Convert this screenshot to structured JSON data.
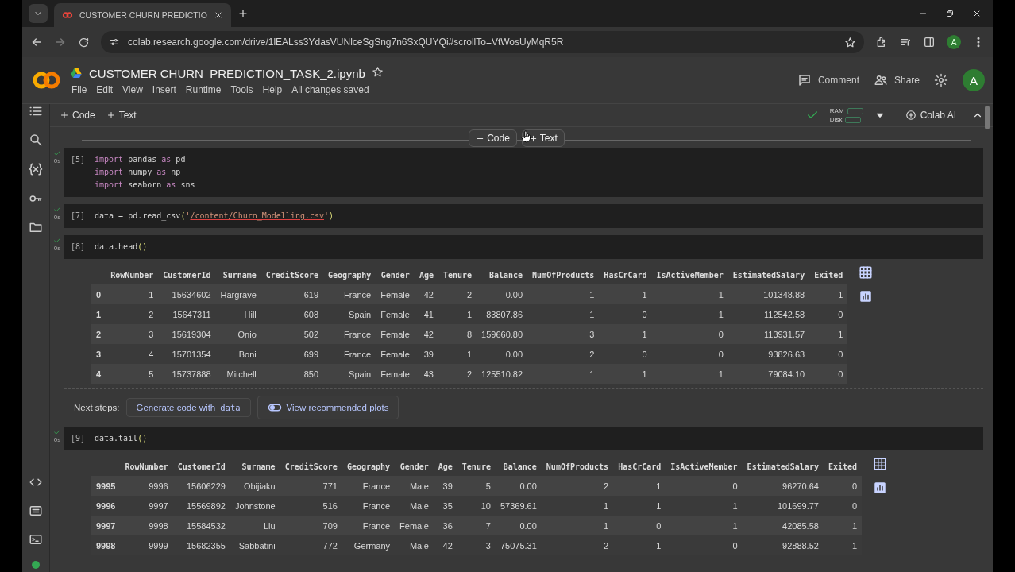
{
  "browser": {
    "tab": {
      "title": "CUSTOMER CHURN PREDICTIO",
      "selected": true
    },
    "url": "colab.research.google.com/drive/1lEALss3YdasVUNlceSgSng7n6SxQUYQi#scrollTo=VtWosUyMqR5R",
    "profile": "A"
  },
  "notebook": {
    "title": "CUSTOMER CHURN  PREDICTION_TASK_2.ipynb",
    "starred": false,
    "menu": [
      "File",
      "Edit",
      "View",
      "Insert",
      "Runtime",
      "Tools",
      "Help"
    ],
    "save_status": "All changes saved",
    "actions": [
      "Comment",
      "Share"
    ],
    "avatar": "A"
  },
  "toolbar": {
    "buttons": [
      "Code",
      "Text"
    ],
    "connected": true,
    "resources": [
      "RAM",
      "Disk"
    ],
    "ai": "Colab AI"
  },
  "insert_bar": [
    "Code",
    "Text"
  ],
  "cells": [
    {
      "count": "[5]",
      "duration": "0s",
      "done": true,
      "lines": [
        [
          {
            "text": "import",
            "kind": "keyword"
          },
          {
            "text": " pandas ",
            "kind": "plain"
          },
          {
            "text": "as",
            "kind": "keyword"
          },
          {
            "text": " pd",
            "kind": "plain"
          }
        ],
        [
          {
            "text": "import",
            "kind": "keyword"
          },
          {
            "text": " numpy ",
            "kind": "plain"
          },
          {
            "text": "as",
            "kind": "keyword"
          },
          {
            "text": " np",
            "kind": "plain"
          }
        ],
        [
          {
            "text": "import",
            "kind": "keyword"
          },
          {
            "text": " seaborn ",
            "kind": "plain"
          },
          {
            "text": "as",
            "kind": "keyword"
          },
          {
            "text": " sns",
            "kind": "plain"
          }
        ]
      ]
    },
    {
      "count": "[7]",
      "duration": "0s",
      "done": true,
      "lines": [
        [
          {
            "text": "data = pd.read_csv",
            "kind": "plain"
          },
          {
            "text": "(",
            "kind": "paren"
          },
          {
            "text": "'",
            "kind": "quote"
          },
          {
            "text": "/content/Churn_Modelling.csv",
            "kind": "path"
          },
          {
            "text": "'",
            "kind": "quote"
          },
          {
            "text": ")",
            "kind": "paren"
          }
        ]
      ]
    },
    {
      "count": "[8]",
      "duration": "0s",
      "done": true,
      "lines": [
        [
          {
            "text": "data.head",
            "kind": "plain"
          },
          {
            "text": "()",
            "kind": "paren"
          }
        ]
      ],
      "output": {
        "columns": [
          "RowNumber",
          "CustomerId",
          "Surname",
          "CreditScore",
          "Geography",
          "Gender",
          "Age",
          "Tenure",
          "Balance",
          "NumOfProducts",
          "HasCrCard",
          "IsActiveMember",
          "EstimatedSalary",
          "Exited"
        ],
        "rows": [
          {
            "index": "0",
            "cells": [
              "1",
              "15634602",
              "Hargrave",
              "619",
              "France",
              "Female",
              "42",
              "2",
              "0.00",
              "1",
              "1",
              "1",
              "101348.88",
              "1"
            ]
          },
          {
            "index": "1",
            "cells": [
              "2",
              "15647311",
              "Hill",
              "608",
              "Spain",
              "Female",
              "41",
              "1",
              "83807.86",
              "1",
              "0",
              "1",
              "112542.58",
              "0"
            ]
          },
          {
            "index": "2",
            "cells": [
              "3",
              "15619304",
              "Onio",
              "502",
              "France",
              "Female",
              "42",
              "8",
              "159660.80",
              "3",
              "1",
              "0",
              "113931.57",
              "1"
            ]
          },
          {
            "index": "3",
            "cells": [
              "4",
              "15701354",
              "Boni",
              "699",
              "France",
              "Female",
              "39",
              "1",
              "0.00",
              "2",
              "0",
              "0",
              "93826.63",
              "0"
            ]
          },
          {
            "index": "4",
            "cells": [
              "5",
              "15737888",
              "Mitchell",
              "850",
              "Spain",
              "Female",
              "43",
              "2",
              "125510.82",
              "1",
              "1",
              "1",
              "79084.10",
              "0"
            ]
          }
        ],
        "next_steps": {
          "label": "Next steps:",
          "generate": "Generate code with",
          "variable": "data",
          "plots": "View recommended plots"
        }
      }
    },
    {
      "count": "[9]",
      "duration": "0s",
      "done": true,
      "lines": [
        [
          {
            "text": "data.tail",
            "kind": "plain"
          },
          {
            "text": "()",
            "kind": "paren"
          }
        ]
      ],
      "output": {
        "columns": [
          "RowNumber",
          "CustomerId",
          "Surname",
          "CreditScore",
          "Geography",
          "Gender",
          "Age",
          "Tenure",
          "Balance",
          "NumOfProducts",
          "HasCrCard",
          "IsActiveMember",
          "EstimatedSalary",
          "Exited"
        ],
        "rows": [
          {
            "index": "9995",
            "cells": [
              "9996",
              "15606229",
              "Obijiaku",
              "771",
              "France",
              "Male",
              "39",
              "5",
              "0.00",
              "2",
              "1",
              "0",
              "96270.64",
              "0"
            ]
          },
          {
            "index": "9996",
            "cells": [
              "9997",
              "15569892",
              "Johnstone",
              "516",
              "France",
              "Male",
              "35",
              "10",
              "57369.61",
              "1",
              "1",
              "1",
              "101699.77",
              "0"
            ]
          },
          {
            "index": "9997",
            "cells": [
              "9998",
              "15584532",
              "Liu",
              "709",
              "France",
              "Female",
              "36",
              "7",
              "0.00",
              "1",
              "0",
              "1",
              "42085.58",
              "1"
            ]
          },
          {
            "index": "9998",
            "cells": [
              "9999",
              "15682355",
              "Sabbatini",
              "772",
              "Germany",
              "Male",
              "42",
              "3",
              "75075.31",
              "2",
              "1",
              "0",
              "92888.52",
              "1"
            ]
          }
        ]
      }
    }
  ]
}
